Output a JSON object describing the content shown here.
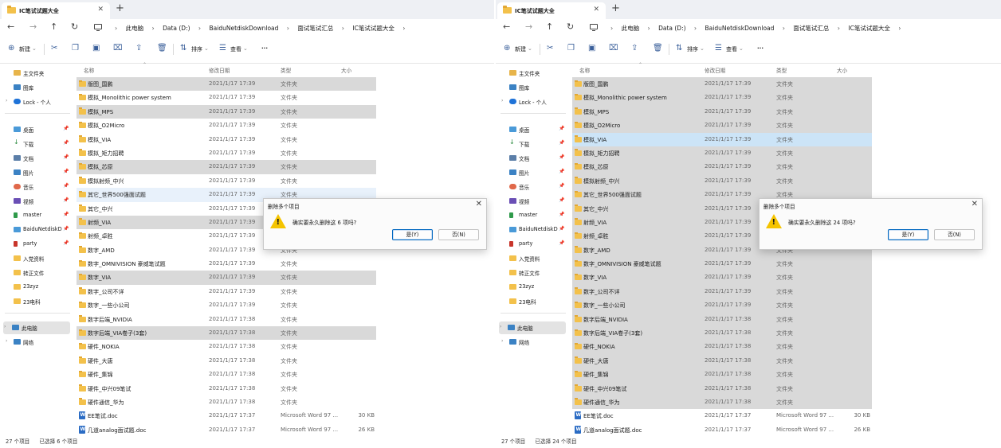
{
  "windows": [
    {
      "tab_title": "IC笔试试题大全",
      "breadcrumbs": [
        "此电脑",
        "Data (D:)",
        "BaiduNetdiskDownload",
        "面试笔试汇总",
        "IC笔试试题大全"
      ],
      "toolbar": {
        "new": "新建",
        "sort": "排序",
        "view": "查看",
        "more": "···"
      },
      "columns": {
        "name": "名称",
        "date": "修改日期",
        "type": "类型",
        "size": "大小"
      },
      "sidebar": [
        {
          "label": "主文件夹"
        },
        {
          "label": "图库"
        },
        {
          "label": "Lock - 个人"
        },
        {
          "label": "桌面"
        },
        {
          "label": "下载"
        },
        {
          "label": "文档"
        },
        {
          "label": "图片"
        },
        {
          "label": "音乐"
        },
        {
          "label": "视频"
        },
        {
          "label": "master"
        },
        {
          "label": "BaiduNetdiskD"
        },
        {
          "label": "party"
        },
        {
          "label": "入党资料"
        },
        {
          "label": "转正文件"
        },
        {
          "label": "23zyz"
        },
        {
          "label": "23电科"
        },
        {
          "label": "此电脑"
        },
        {
          "label": "网络"
        }
      ],
      "rows": [
        {
          "name": "版图_国鹏",
          "date": "2021/1/17 17:39",
          "type": "文件夹",
          "size": "",
          "state": "sel"
        },
        {
          "name": "模拟_Monolithic power system",
          "date": "2021/1/17 17:39",
          "type": "文件夹",
          "size": "",
          "state": ""
        },
        {
          "name": "模拟_MPS",
          "date": "2021/1/17 17:39",
          "type": "文件夹",
          "size": "",
          "state": "sel"
        },
        {
          "name": "模拟_O2Micro",
          "date": "2021/1/17 17:39",
          "type": "文件夹",
          "size": "",
          "state": ""
        },
        {
          "name": "模拟_VIA",
          "date": "2021/1/17 17:39",
          "type": "文件夹",
          "size": "",
          "state": ""
        },
        {
          "name": "模拟_矩力招聘",
          "date": "2021/1/17 17:39",
          "type": "文件夹",
          "size": "",
          "state": ""
        },
        {
          "name": "模拟_芯原",
          "date": "2021/1/17 17:39",
          "type": "文件夹",
          "size": "",
          "state": "sel"
        },
        {
          "name": "模拟射频_中兴",
          "date": "2021/1/17 17:39",
          "type": "文件夹",
          "size": "",
          "state": ""
        },
        {
          "name": "其它_世界500强面试题",
          "date": "2021/1/17 17:39",
          "type": "文件夹",
          "size": "",
          "state": "hover2"
        },
        {
          "name": "其它_中兴",
          "date": "2021/1/17 17:39",
          "type": "文件夹",
          "size": "",
          "state": ""
        },
        {
          "name": "射频_VIA",
          "date": "2021/1/17 17:39",
          "type": "文件夹",
          "size": "",
          "state": "sel"
        },
        {
          "name": "射频_卓胜",
          "date": "2021/1/17 17:39",
          "type": "文件夹",
          "size": "",
          "state": ""
        },
        {
          "name": "数字_AMD",
          "date": "2021/1/17 17:39",
          "type": "文件夹",
          "size": "",
          "state": ""
        },
        {
          "name": "数字_OMNIVISION 豪威笔试题",
          "date": "2021/1/17 17:39",
          "type": "文件夹",
          "size": "",
          "state": ""
        },
        {
          "name": "数字_VIA",
          "date": "2021/1/17 17:39",
          "type": "文件夹",
          "size": "",
          "state": "sel"
        },
        {
          "name": "数字_公司不详",
          "date": "2021/1/17 17:39",
          "type": "文件夹",
          "size": "",
          "state": ""
        },
        {
          "name": "数字_一些小公司",
          "date": "2021/1/17 17:39",
          "type": "文件夹",
          "size": "",
          "state": ""
        },
        {
          "name": "数字后端_NVIDIA",
          "date": "2021/1/17 17:38",
          "type": "文件夹",
          "size": "",
          "state": ""
        },
        {
          "name": "数字后端_VIA卷子(3套)",
          "date": "2021/1/17 17:38",
          "type": "文件夹",
          "size": "",
          "state": "sel"
        },
        {
          "name": "硬件_NOKIA",
          "date": "2021/1/17 17:38",
          "type": "文件夹",
          "size": "",
          "state": ""
        },
        {
          "name": "硬件_大唐",
          "date": "2021/1/17 17:38",
          "type": "文件夹",
          "size": "",
          "state": ""
        },
        {
          "name": "硬件_集锦",
          "date": "2021/1/17 17:38",
          "type": "文件夹",
          "size": "",
          "state": ""
        },
        {
          "name": "硬件_中兴09笔试",
          "date": "2021/1/17 17:38",
          "type": "文件夹",
          "size": "",
          "state": ""
        },
        {
          "name": "硬件通信_华为",
          "date": "2021/1/17 17:38",
          "type": "文件夹",
          "size": "",
          "state": ""
        },
        {
          "name": "EE笔试.doc",
          "date": "2021/1/17 17:37",
          "type": "Microsoft Word 97 ...",
          "size": "30 KB",
          "state": "",
          "doc": true
        },
        {
          "name": "几道analog面试题.doc",
          "date": "2021/1/17 17:37",
          "type": "Microsoft Word 97 ...",
          "size": "26 KB",
          "state": "",
          "doc": true
        }
      ],
      "status": {
        "count": "27 个项目",
        "selected": "已选择 6 个项目"
      },
      "dialog": {
        "title": "删除多个项目",
        "message": "确实要永久删除这 6 项吗?",
        "yes": "是(Y)",
        "no": "否(N)"
      }
    },
    {
      "tab_title": "IC笔试试题大全",
      "breadcrumbs": [
        "此电脑",
        "Data (D:)",
        "BaiduNetdiskDownload",
        "面试笔试汇总",
        "IC笔试试题大全"
      ],
      "toolbar": {
        "new": "新建",
        "sort": "排序",
        "view": "查看",
        "more": "···"
      },
      "columns": {
        "name": "名称",
        "date": "修改日期",
        "type": "类型",
        "size": "大小"
      },
      "sidebar": [
        {
          "label": "主文件夹"
        },
        {
          "label": "图库"
        },
        {
          "label": "Lock - 个人"
        },
        {
          "label": "桌面"
        },
        {
          "label": "下载"
        },
        {
          "label": "文档"
        },
        {
          "label": "图片"
        },
        {
          "label": "音乐"
        },
        {
          "label": "视频"
        },
        {
          "label": "master"
        },
        {
          "label": "BaiduNetdiskD"
        },
        {
          "label": "party"
        },
        {
          "label": "入党资料"
        },
        {
          "label": "转正文件"
        },
        {
          "label": "23zyz"
        },
        {
          "label": "23电科"
        },
        {
          "label": "此电脑"
        },
        {
          "label": "网络"
        }
      ],
      "rows": [
        {
          "name": "版图_国鹏",
          "date": "2021/1/17 17:39",
          "type": "文件夹",
          "size": "",
          "state": "sel"
        },
        {
          "name": "模拟_Monolithic power system",
          "date": "2021/1/17 17:39",
          "type": "文件夹",
          "size": "",
          "state": "sel"
        },
        {
          "name": "模拟_MPS",
          "date": "2021/1/17 17:39",
          "type": "文件夹",
          "size": "",
          "state": "sel"
        },
        {
          "name": "模拟_O2Micro",
          "date": "2021/1/17 17:39",
          "type": "文件夹",
          "size": "",
          "state": "sel"
        },
        {
          "name": "模拟_VIA",
          "date": "2021/1/17 17:39",
          "type": "文件夹",
          "size": "",
          "state": "hover"
        },
        {
          "name": "模拟_矩力招聘",
          "date": "2021/1/17 17:39",
          "type": "文件夹",
          "size": "",
          "state": "sel"
        },
        {
          "name": "模拟_芯原",
          "date": "2021/1/17 17:39",
          "type": "文件夹",
          "size": "",
          "state": "sel"
        },
        {
          "name": "模拟射频_中兴",
          "date": "2021/1/17 17:39",
          "type": "文件夹",
          "size": "",
          "state": "sel"
        },
        {
          "name": "其它_世界500强面试题",
          "date": "2021/1/17 17:39",
          "type": "文件夹",
          "size": "",
          "state": "sel"
        },
        {
          "name": "其它_中兴",
          "date": "2021/1/17 17:39",
          "type": "文件夹",
          "size": "",
          "state": "sel"
        },
        {
          "name": "射频_VIA",
          "date": "2021/1/17 17:39",
          "type": "文件夹",
          "size": "",
          "state": "sel"
        },
        {
          "name": "射频_卓胜",
          "date": "2021/1/17 17:39",
          "type": "文件夹",
          "size": "",
          "state": "sel"
        },
        {
          "name": "数字_AMD",
          "date": "2021/1/17 17:39",
          "type": "文件夹",
          "size": "",
          "state": "sel"
        },
        {
          "name": "数字_OMNIVISION 豪威笔试题",
          "date": "2021/1/17 17:39",
          "type": "文件夹",
          "size": "",
          "state": "sel"
        },
        {
          "name": "数字_VIA",
          "date": "2021/1/17 17:39",
          "type": "文件夹",
          "size": "",
          "state": "sel"
        },
        {
          "name": "数字_公司不详",
          "date": "2021/1/17 17:39",
          "type": "文件夹",
          "size": "",
          "state": "sel"
        },
        {
          "name": "数字_一些小公司",
          "date": "2021/1/17 17:39",
          "type": "文件夹",
          "size": "",
          "state": "sel"
        },
        {
          "name": "数字后端_NVIDIA",
          "date": "2021/1/17 17:38",
          "type": "文件夹",
          "size": "",
          "state": "sel"
        },
        {
          "name": "数字后端_VIA卷子(3套)",
          "date": "2021/1/17 17:38",
          "type": "文件夹",
          "size": "",
          "state": "sel"
        },
        {
          "name": "硬件_NOKIA",
          "date": "2021/1/17 17:38",
          "type": "文件夹",
          "size": "",
          "state": "sel"
        },
        {
          "name": "硬件_大唐",
          "date": "2021/1/17 17:38",
          "type": "文件夹",
          "size": "",
          "state": "sel"
        },
        {
          "name": "硬件_集锦",
          "date": "2021/1/17 17:38",
          "type": "文件夹",
          "size": "",
          "state": "sel"
        },
        {
          "name": "硬件_中兴09笔试",
          "date": "2021/1/17 17:38",
          "type": "文件夹",
          "size": "",
          "state": "sel"
        },
        {
          "name": "硬件通信_华为",
          "date": "2021/1/17 17:38",
          "type": "文件夹",
          "size": "",
          "state": "sel"
        },
        {
          "name": "EE笔试.doc",
          "date": "2021/1/17 17:37",
          "type": "Microsoft Word 97 ...",
          "size": "30 KB",
          "state": "",
          "doc": true
        },
        {
          "name": "几道analog面试题.doc",
          "date": "2021/1/17 17:37",
          "type": "Microsoft Word 97 ...",
          "size": "26 KB",
          "state": "",
          "doc": true
        }
      ],
      "status": {
        "count": "27 个项目",
        "selected": "已选择 24 个项目"
      },
      "dialog": {
        "title": "删除多个项目",
        "message": "确实要永久删除这 24 项吗?",
        "yes": "是(Y)",
        "no": "否(N)"
      }
    }
  ],
  "icons": {
    "back": "arrow-left-icon",
    "forward": "arrow-right-icon",
    "up": "arrow-up-icon",
    "refresh": "refresh-icon",
    "cut": "scissors-icon",
    "copy": "copy-icon",
    "paste": "paste-icon",
    "rename": "rename-icon",
    "share": "share-icon",
    "delete": "trash-icon",
    "warning": "warning-icon"
  },
  "colors": {
    "selection": "#d9d9d9",
    "hover": "#cce4f7",
    "folder": "#f3c14b",
    "accent": "#0067c0",
    "warning": "#f5c400"
  }
}
